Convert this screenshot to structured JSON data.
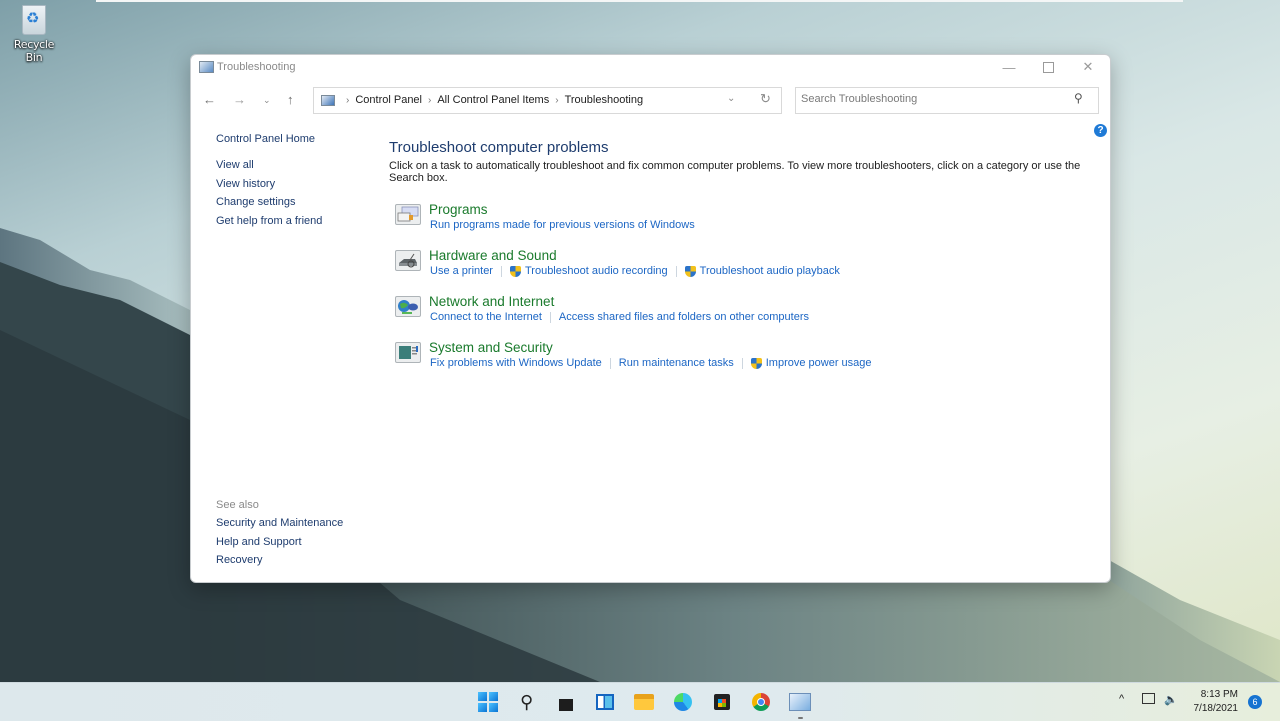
{
  "desktop": {
    "recycle_bin_label": "Recycle Bin"
  },
  "window": {
    "title": "Troubleshooting",
    "controls": {
      "minimize": "—",
      "close": "✕"
    }
  },
  "navigation": {
    "back_icon": "←",
    "forward_icon": "→",
    "recent_icon": "⌄",
    "up_icon": "↑",
    "breadcrumb": [
      "Control Panel",
      "All Control Panel Items",
      "Troubleshooting"
    ],
    "breadcrumb_separator": "›",
    "dropdown_icon": "⌄",
    "refresh_icon": "↻"
  },
  "search": {
    "placeholder": "Search Troubleshooting",
    "value": "",
    "icon": "⚲"
  },
  "help": {
    "icon": "?"
  },
  "left_pane": {
    "home": "Control Panel Home",
    "items": [
      "View all",
      "View history",
      "Change settings",
      "Get help from a friend"
    ]
  },
  "see_also": {
    "header": "See also",
    "items": [
      "Security and Maintenance",
      "Help and Support",
      "Recovery"
    ]
  },
  "main": {
    "title": "Troubleshoot computer problems",
    "description": "Click on a task to automatically troubleshoot and fix common computer problems. To view more troubleshooters, click on a category or use the Search box.",
    "categories": [
      {
        "title": "Programs",
        "icon": "programs-icon",
        "tasks": [
          {
            "label": "Run programs made for previous versions of Windows",
            "shield": false
          }
        ]
      },
      {
        "title": "Hardware and Sound",
        "icon": "hardware-sound-icon",
        "tasks": [
          {
            "label": "Use a printer",
            "shield": false
          },
          {
            "label": "Troubleshoot audio recording",
            "shield": true
          },
          {
            "label": "Troubleshoot audio playback",
            "shield": true
          }
        ]
      },
      {
        "title": "Network and Internet",
        "icon": "network-internet-icon",
        "tasks": [
          {
            "label": "Connect to the Internet",
            "shield": false
          },
          {
            "label": "Access shared files and folders on other computers",
            "shield": false
          }
        ]
      },
      {
        "title": "System and Security",
        "icon": "system-security-icon",
        "tasks": [
          {
            "label": "Fix problems with Windows Update",
            "shield": false
          },
          {
            "label": "Run maintenance tasks",
            "shield": false
          },
          {
            "label": "Improve power usage",
            "shield": true
          }
        ]
      }
    ]
  },
  "taskbar": {
    "apps": [
      "Start",
      "Search",
      "Task View",
      "Widgets",
      "File Explorer",
      "Microsoft Edge",
      "Microsoft Store",
      "Google Chrome",
      "Control Panel"
    ],
    "active_app": "Control Panel",
    "tray": {
      "chevron": "^",
      "volume_icon": "🔈"
    },
    "time": "8:13 PM",
    "date": "7/18/2021",
    "notification_count": "6"
  },
  "colors": {
    "link_blue": "#1c66c4",
    "category_green": "#1a7a2c",
    "heading_navy": "#1e3c6e",
    "accent": "#1f7ad6"
  }
}
